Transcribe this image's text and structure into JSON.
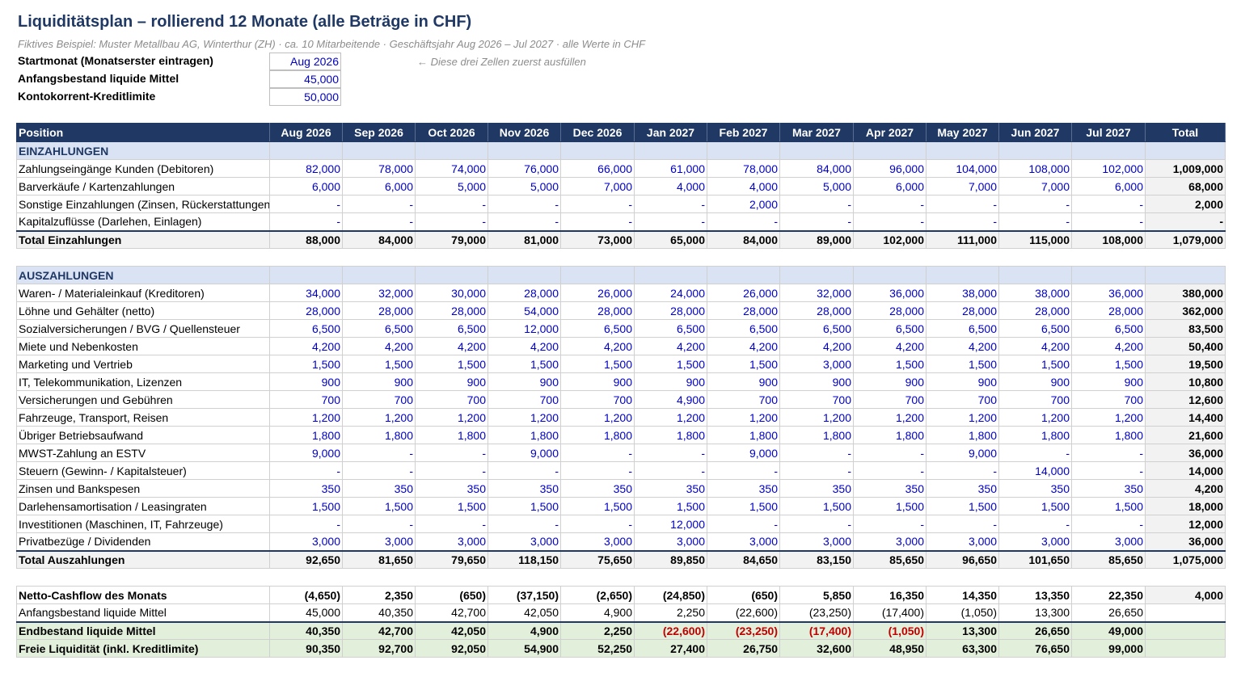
{
  "title": "Liquiditätsplan – rollierend 12 Monate (alle Beträge in CHF)",
  "subtitle": "Fiktives Beispiel: Muster Metallbau AG, Winterthur (ZH) · ca. 10 Mitarbeitende · Geschäftsjahr Aug 2026 – Jul 2027 · alle Werte in CHF",
  "params": {
    "start_label": "Startmonat (Monatserster eintragen)",
    "start_value": "Aug 2026",
    "opening_label": "Anfangsbestand liquide Mittel",
    "opening_value": "45,000",
    "limit_label": "Kontokorrent-Kreditlimite",
    "limit_value": "50,000",
    "hint": "← Diese drei Zellen zuerst ausfüllen"
  },
  "header": {
    "position": "Position",
    "months": [
      "Aug 2026",
      "Sep 2026",
      "Oct 2026",
      "Nov 2026",
      "Dec 2026",
      "Jan 2027",
      "Feb 2027",
      "Mar 2027",
      "Apr 2027",
      "May 2027",
      "Jun 2027",
      "Jul 2027"
    ],
    "total": "Total"
  },
  "einzahlungen": {
    "section": "EINZAHLUNGEN",
    "rows": [
      {
        "label": "Zahlungseingänge Kunden (Debitoren)",
        "values": [
          "82,000",
          "78,000",
          "74,000",
          "76,000",
          "66,000",
          "61,000",
          "78,000",
          "84,000",
          "96,000",
          "104,000",
          "108,000",
          "102,000"
        ],
        "total": "1,009,000"
      },
      {
        "label": "Barverkäufe / Kartenzahlungen",
        "values": [
          "6,000",
          "6,000",
          "5,000",
          "5,000",
          "7,000",
          "4,000",
          "4,000",
          "5,000",
          "6,000",
          "7,000",
          "7,000",
          "6,000"
        ],
        "total": "68,000"
      },
      {
        "label": "Sonstige Einzahlungen (Zinsen, Rückerstattungen)",
        "values": [
          "-",
          "-",
          "-",
          "-",
          "-",
          "-",
          "2,000",
          "-",
          "-",
          "-",
          "-",
          "-"
        ],
        "total": "2,000"
      },
      {
        "label": "Kapitalzuflüsse (Darlehen, Einlagen)",
        "values": [
          "-",
          "-",
          "-",
          "-",
          "-",
          "-",
          "-",
          "-",
          "-",
          "-",
          "-",
          "-"
        ],
        "total": "-"
      }
    ],
    "total": {
      "label": "Total Einzahlungen",
      "values": [
        "88,000",
        "84,000",
        "79,000",
        "81,000",
        "73,000",
        "65,000",
        "84,000",
        "89,000",
        "102,000",
        "111,000",
        "115,000",
        "108,000"
      ],
      "total": "1,079,000"
    }
  },
  "auszahlungen": {
    "section": "AUSZAHLUNGEN",
    "rows": [
      {
        "label": "Waren- / Materialeinkauf (Kreditoren)",
        "values": [
          "34,000",
          "32,000",
          "30,000",
          "28,000",
          "26,000",
          "24,000",
          "26,000",
          "32,000",
          "36,000",
          "38,000",
          "38,000",
          "36,000"
        ],
        "total": "380,000"
      },
      {
        "label": "Löhne und Gehälter (netto)",
        "values": [
          "28,000",
          "28,000",
          "28,000",
          "54,000",
          "28,000",
          "28,000",
          "28,000",
          "28,000",
          "28,000",
          "28,000",
          "28,000",
          "28,000"
        ],
        "total": "362,000"
      },
      {
        "label": "Sozialversicherungen / BVG / Quellensteuer",
        "values": [
          "6,500",
          "6,500",
          "6,500",
          "12,000",
          "6,500",
          "6,500",
          "6,500",
          "6,500",
          "6,500",
          "6,500",
          "6,500",
          "6,500"
        ],
        "total": "83,500"
      },
      {
        "label": "Miete und Nebenkosten",
        "values": [
          "4,200",
          "4,200",
          "4,200",
          "4,200",
          "4,200",
          "4,200",
          "4,200",
          "4,200",
          "4,200",
          "4,200",
          "4,200",
          "4,200"
        ],
        "total": "50,400"
      },
      {
        "label": "Marketing und Vertrieb",
        "values": [
          "1,500",
          "1,500",
          "1,500",
          "1,500",
          "1,500",
          "1,500",
          "1,500",
          "3,000",
          "1,500",
          "1,500",
          "1,500",
          "1,500"
        ],
        "total": "19,500"
      },
      {
        "label": "IT, Telekommunikation, Lizenzen",
        "values": [
          "900",
          "900",
          "900",
          "900",
          "900",
          "900",
          "900",
          "900",
          "900",
          "900",
          "900",
          "900"
        ],
        "total": "10,800"
      },
      {
        "label": "Versicherungen und Gebühren",
        "values": [
          "700",
          "700",
          "700",
          "700",
          "700",
          "4,900",
          "700",
          "700",
          "700",
          "700",
          "700",
          "700"
        ],
        "total": "12,600"
      },
      {
        "label": "Fahrzeuge, Transport, Reisen",
        "values": [
          "1,200",
          "1,200",
          "1,200",
          "1,200",
          "1,200",
          "1,200",
          "1,200",
          "1,200",
          "1,200",
          "1,200",
          "1,200",
          "1,200"
        ],
        "total": "14,400"
      },
      {
        "label": "Übriger Betriebsaufwand",
        "values": [
          "1,800",
          "1,800",
          "1,800",
          "1,800",
          "1,800",
          "1,800",
          "1,800",
          "1,800",
          "1,800",
          "1,800",
          "1,800",
          "1,800"
        ],
        "total": "21,600"
      },
      {
        "label": "MWST-Zahlung an ESTV",
        "values": [
          "9,000",
          "-",
          "-",
          "9,000",
          "-",
          "-",
          "9,000",
          "-",
          "-",
          "9,000",
          "-",
          "-"
        ],
        "total": "36,000"
      },
      {
        "label": "Steuern (Gewinn- / Kapitalsteuer)",
        "values": [
          "-",
          "-",
          "-",
          "-",
          "-",
          "-",
          "-",
          "-",
          "-",
          "-",
          "14,000",
          "-"
        ],
        "total": "14,000"
      },
      {
        "label": "Zinsen und Bankspesen",
        "values": [
          "350",
          "350",
          "350",
          "350",
          "350",
          "350",
          "350",
          "350",
          "350",
          "350",
          "350",
          "350"
        ],
        "total": "4,200"
      },
      {
        "label": "Darlehensamortisation / Leasingraten",
        "values": [
          "1,500",
          "1,500",
          "1,500",
          "1,500",
          "1,500",
          "1,500",
          "1,500",
          "1,500",
          "1,500",
          "1,500",
          "1,500",
          "1,500"
        ],
        "total": "18,000"
      },
      {
        "label": "Investitionen (Maschinen, IT, Fahrzeuge)",
        "values": [
          "-",
          "-",
          "-",
          "-",
          "-",
          "12,000",
          "-",
          "-",
          "-",
          "-",
          "-",
          "-"
        ],
        "total": "12,000"
      },
      {
        "label": "Privatbezüge / Dividenden",
        "values": [
          "3,000",
          "3,000",
          "3,000",
          "3,000",
          "3,000",
          "3,000",
          "3,000",
          "3,000",
          "3,000",
          "3,000",
          "3,000",
          "3,000"
        ],
        "total": "36,000"
      }
    ],
    "total": {
      "label": "Total Auszahlungen",
      "values": [
        "92,650",
        "81,650",
        "79,650",
        "118,150",
        "75,650",
        "89,850",
        "84,650",
        "83,150",
        "85,650",
        "96,650",
        "101,650",
        "85,650"
      ],
      "total": "1,075,000"
    }
  },
  "summary": {
    "netto": {
      "label": "Netto-Cashflow des Monats",
      "values": [
        "(4,650)",
        "2,350",
        "(650)",
        "(37,150)",
        "(2,650)",
        "(24,850)",
        "(650)",
        "5,850",
        "16,350",
        "14,350",
        "13,350",
        "22,350"
      ],
      "total": "4,000"
    },
    "anfang": {
      "label": "Anfangsbestand liquide Mittel",
      "values": [
        "45,000",
        "40,350",
        "42,700",
        "42,050",
        "4,900",
        "2,250",
        "(22,600)",
        "(23,250)",
        "(17,400)",
        "(1,050)",
        "13,300",
        "26,650"
      ],
      "total": ""
    },
    "endbestand": {
      "label": "Endbestand liquide Mittel",
      "values": [
        "40,350",
        "42,700",
        "42,050",
        "4,900",
        "2,250",
        "(22,600)",
        "(23,250)",
        "(17,400)",
        "(1,050)",
        "13,300",
        "26,650",
        "49,000"
      ],
      "total": ""
    },
    "frei": {
      "label": "Freie Liquidität (inkl. Kreditlimite)",
      "values": [
        "90,350",
        "92,700",
        "92,050",
        "54,900",
        "52,250",
        "27,400",
        "26,750",
        "32,600",
        "48,950",
        "63,300",
        "76,650",
        "99,000"
      ],
      "total": ""
    }
  },
  "colors": {
    "header": "#1f3864",
    "input": "#0000c8",
    "negative": "#c00000",
    "section": "#dae3f3",
    "end": "#e2efda"
  }
}
